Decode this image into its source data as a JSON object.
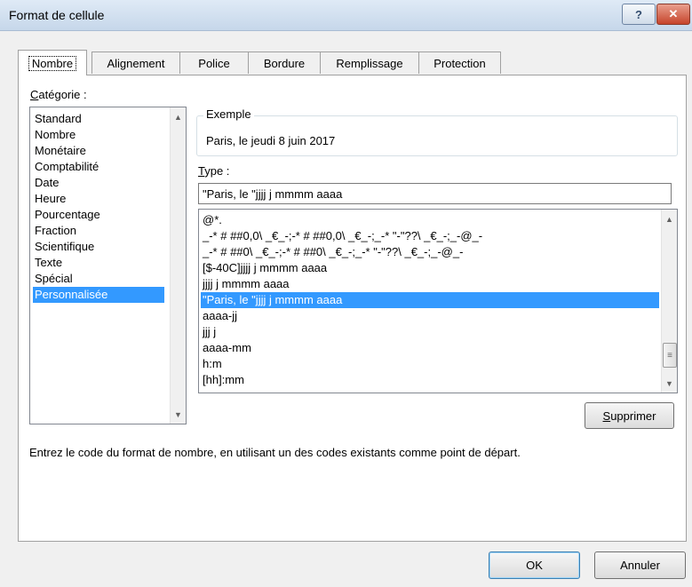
{
  "window": {
    "title": "Format de cellule",
    "help_label": "?",
    "close_label": "✕"
  },
  "tabs": [
    {
      "label": "Nombre"
    },
    {
      "label": "Alignement"
    },
    {
      "label": "Police"
    },
    {
      "label": "Bordure"
    },
    {
      "label": "Remplissage"
    },
    {
      "label": "Protection"
    }
  ],
  "category": {
    "label": "atégorie :",
    "label_accel": "C",
    "items": [
      {
        "label": "Standard"
      },
      {
        "label": "Nombre"
      },
      {
        "label": "Monétaire"
      },
      {
        "label": "Comptabilité"
      },
      {
        "label": "Date"
      },
      {
        "label": "Heure"
      },
      {
        "label": "Pourcentage"
      },
      {
        "label": "Fraction"
      },
      {
        "label": "Scientifique"
      },
      {
        "label": "Texte"
      },
      {
        "label": "Spécial"
      },
      {
        "label": "Personnalisée"
      }
    ],
    "selected": "Personnalisée"
  },
  "example": {
    "label": "Exemple",
    "value": "Paris, le jeudi 8 juin 2017"
  },
  "type": {
    "label": "ype :",
    "label_accel": "T",
    "value": "\"Paris, le \"jjjj j mmmm aaaa"
  },
  "formats": [
    {
      "code": "@*."
    },
    {
      "code": "_-* # ##0,0\\ _€_-;-* # ##0,0\\ _€_-;_-* \"-\"??\\ _€_-;_-@_-"
    },
    {
      "code": "_-* # ##0\\ _€_-;-* # ##0\\ _€_-;_-* \"-\"??\\ _€_-;_-@_-"
    },
    {
      "code": "[$-40C]jjjj j mmmm aaaa"
    },
    {
      "code": "jjjj j mmmm aaaa"
    },
    {
      "code": "\"Paris, le \"jjjj j mmmm aaaa"
    },
    {
      "code": "aaaa-jj"
    },
    {
      "code": "jjj j"
    },
    {
      "code": "aaaa-mm"
    },
    {
      "code": "h:m"
    },
    {
      "code": "[hh]:mm"
    }
  ],
  "delete_button": {
    "accel": "S",
    "label": "upprimer"
  },
  "hint": "Entrez le code du format de nombre, en utilisant un des codes existants comme point de départ.",
  "ok_label": "OK",
  "cancel_label": "Annuler",
  "colors": {
    "selection": "#3399ff",
    "titlebar": "#dfeaf6",
    "close": "#c6442b"
  }
}
